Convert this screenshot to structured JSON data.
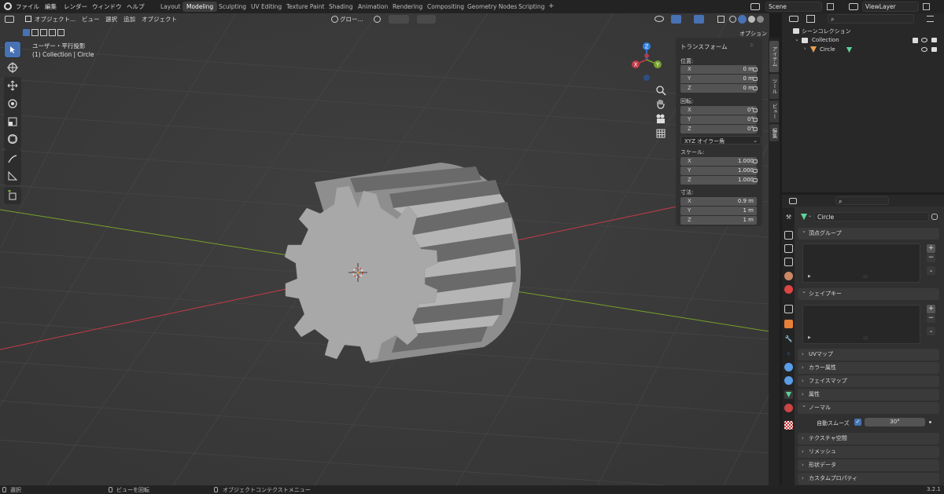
{
  "topbar": {
    "menus": [
      "ファイル",
      "編集",
      "レンダー",
      "ウィンドウ",
      "ヘルプ"
    ],
    "workspaces": [
      "Layout",
      "Modeling",
      "Sculpting",
      "UV Editing",
      "Texture Paint",
      "Shading",
      "Animation",
      "Rendering",
      "Compositing",
      "Geometry Nodes",
      "Scripting"
    ],
    "active_workspace": "Modeling",
    "add_tab": "+",
    "scene": "Scene",
    "view_layer": "ViewLayer"
  },
  "viewport_header": {
    "mode": "オブジェクト...",
    "menus": [
      "ビュー",
      "選択",
      "追加",
      "オブジェクト"
    ],
    "orientation": "グロー...",
    "options": "オプション"
  },
  "viewport": {
    "view_name": "ユーザー・平行投影",
    "collection_info": "(1) Collection | Circle",
    "gizmo": {
      "x": "X",
      "y": "Y",
      "z": "Z"
    }
  },
  "npanel": {
    "title": "トランスフォーム",
    "location_label": "位置:",
    "location": [
      {
        "k": "X",
        "v": "0 m"
      },
      {
        "k": "Y",
        "v": "0 m"
      },
      {
        "k": "Z",
        "v": "0 m"
      }
    ],
    "rotation_label": "回転:",
    "rotation": [
      {
        "k": "X",
        "v": "0°"
      },
      {
        "k": "Y",
        "v": "0°"
      },
      {
        "k": "Z",
        "v": "0°"
      }
    ],
    "rotation_mode": "XYZ オイラー角",
    "scale_label": "スケール:",
    "scale": [
      {
        "k": "X",
        "v": "1.000"
      },
      {
        "k": "Y",
        "v": "1.000"
      },
      {
        "k": "Z",
        "v": "1.000"
      }
    ],
    "dimensions_label": "寸法:",
    "dimensions": [
      {
        "k": "X",
        "v": "0.9 m"
      },
      {
        "k": "Y",
        "v": "1 m"
      },
      {
        "k": "Z",
        "v": "1 m"
      }
    ],
    "tabs": [
      "アイテム",
      "ツール",
      "ビュー",
      "編集"
    ]
  },
  "outliner": {
    "scene_collection": "シーンコレクション",
    "collection": "Collection",
    "object": "Circle"
  },
  "properties": {
    "object_name": "Circle",
    "sections": {
      "vertex_groups": "頂点グループ",
      "shape_keys": "シェイプキー",
      "uv_maps": "UVマップ",
      "color_attributes": "カラー属性",
      "face_maps": "フェイスマップ",
      "attributes": "属性",
      "normals": "ノーマル",
      "texture_space": "テクスチャ空間",
      "remesh": "リメッシュ",
      "shape_data": "形状データ",
      "custom_props": "カスタムプロパティ"
    },
    "auto_smooth_label": "自動スムーズ",
    "auto_smooth_angle": "30°",
    "list_dots": ":::"
  },
  "statusbar": {
    "select": "選択",
    "rotate_view": "ビューを回転",
    "context_menu": "オブジェクトコンテクストメニュー",
    "version": "3.2.1"
  },
  "colors": {
    "accent": "#4772b3",
    "x_axis": "#c53b48",
    "y_axis": "#77a12a",
    "z_axis": "#2f7fe0",
    "mesh": "#a4a4a4"
  }
}
